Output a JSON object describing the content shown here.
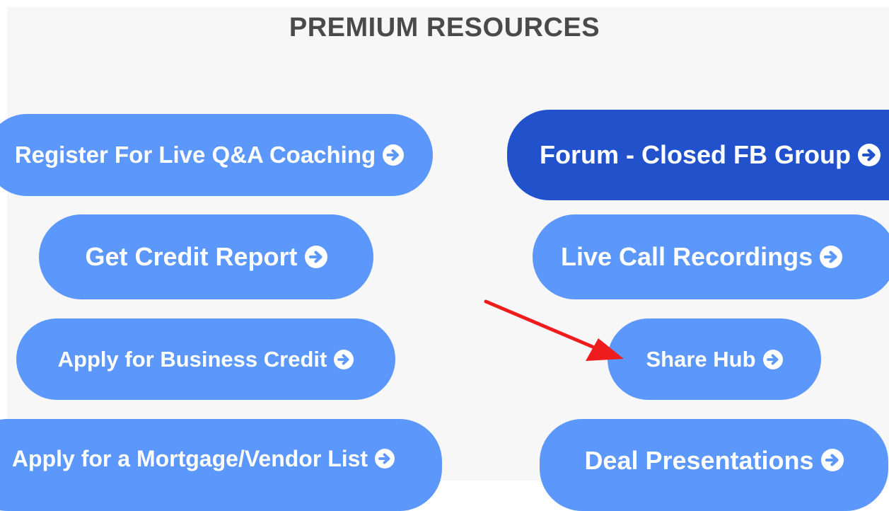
{
  "section": {
    "title": "PREMIUM RESOURCES"
  },
  "buttons": {
    "register_qa": "Register For Live Q&A Coaching",
    "forum": "Forum - Closed FB Group",
    "credit_report": "Get Credit Report",
    "call_recordings": "Live Call Recordings",
    "business_credit": "Apply for Business Credit",
    "share_hub": "Share Hub",
    "mortgage_vendor": "Apply for a Mortgage/Vendor List",
    "deal_presentations": "Deal Presentations"
  },
  "icons": {
    "button_arrow": "arrow-circle-right-icon",
    "annotation": "red-arrow-annotation"
  },
  "colors": {
    "button_blue": "#5c97fc",
    "button_dark_blue": "#2152cc",
    "annotation_red": "#ee1c1c",
    "title_gray": "#4a4a4a",
    "panel_bg": "#f7f7f8"
  }
}
